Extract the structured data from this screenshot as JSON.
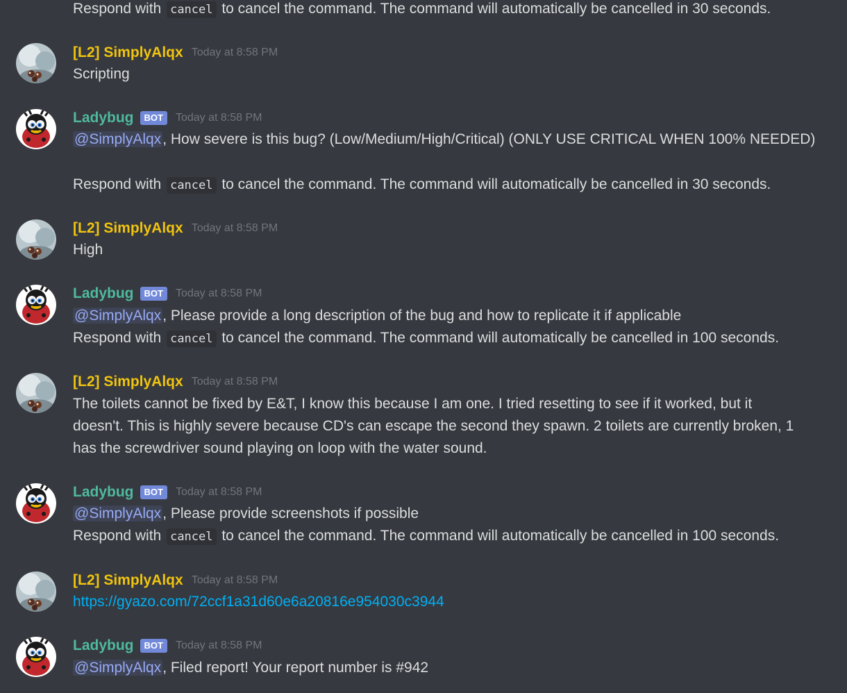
{
  "colors": {
    "background": "#36393f",
    "bot_name": "#4fb9a0",
    "user_name": "#f1c40f",
    "bot_badge": "#7289da",
    "mention": "#99aaf5",
    "link": "#00b0f4",
    "timestamp": "#72767d"
  },
  "messages": [
    {
      "lines": [
        {
          "pre": "Respond with ",
          "code": "cancel",
          "post": " to cancel the command. The command will automatically be cancelled in 30 seconds."
        }
      ]
    },
    {
      "author": "[L2] SimplyAlqx",
      "timestamp": "Today at 8:58 PM",
      "avatar_icon": "rocky-avatar-icon",
      "text": "Scripting"
    },
    {
      "author": "Ladybug",
      "badge": "BOT",
      "timestamp": "Today at 8:58 PM",
      "avatar_icon": "ladybug-avatar-icon",
      "mention": "@SimplyAlqx",
      "text": ", How severe is this bug? (Low/Medium/High/Critical) (ONLY USE CRITICAL WHEN 100% NEEDED)",
      "pre": "Respond with ",
      "code": "cancel",
      "post": " to cancel the command. The command will automatically be cancelled in 30 seconds."
    },
    {
      "author": "[L2] SimplyAlqx",
      "timestamp": "Today at 8:58 PM",
      "avatar_icon": "rocky-avatar-icon",
      "text": "High"
    },
    {
      "author": "Ladybug",
      "badge": "BOT",
      "timestamp": "Today at 8:58 PM",
      "avatar_icon": "ladybug-avatar-icon",
      "mention": "@SimplyAlqx",
      "text": ", Please provide a long description of the bug and how to replicate it if applicable",
      "pre": "Respond with ",
      "code": "cancel",
      "post": " to cancel the command. The command will automatically be cancelled in 100 seconds."
    },
    {
      "author": "[L2] SimplyAlqx",
      "timestamp": "Today at 8:58 PM",
      "avatar_icon": "rocky-avatar-icon",
      "line1": "The toilets cannot be fixed by E&T, I know this because I am one. I tried resetting to see if it worked, but it",
      "line2": "doesn't. This is highly severe because CD's can escape the second they spawn. 2 toilets are currently broken, 1",
      "line3": "has the screwdriver sound playing on loop with the water sound."
    },
    {
      "author": "Ladybug",
      "badge": "BOT",
      "timestamp": "Today at 8:58 PM",
      "avatar_icon": "ladybug-avatar-icon",
      "mention": "@SimplyAlqx",
      "text": ", Please provide screenshots if possible",
      "pre": "Respond with ",
      "code": "cancel",
      "post": " to cancel the command. The command will automatically be cancelled in 100 seconds."
    },
    {
      "author": "[L2] SimplyAlqx",
      "timestamp": "Today at 8:58 PM",
      "avatar_icon": "rocky-avatar-icon",
      "link": "https://gyazo.com/72ccf1a31d60e6a20816e954030c3944"
    },
    {
      "author": "Ladybug",
      "badge": "BOT",
      "timestamp": "Today at 8:58 PM",
      "avatar_icon": "ladybug-avatar-icon",
      "mention": "@SimplyAlqx",
      "text": ", Filed report! Your report number is #942"
    }
  ]
}
